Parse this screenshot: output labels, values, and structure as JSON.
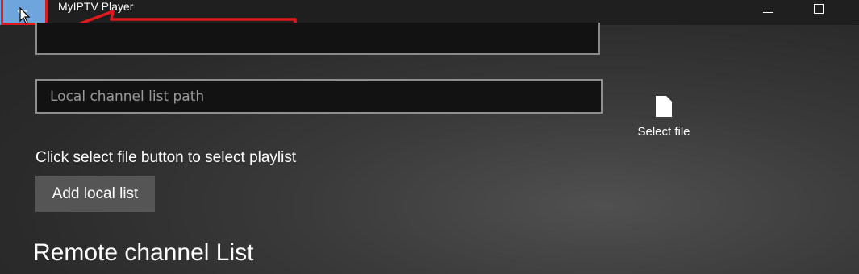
{
  "titlebar": {
    "app_title": "MyIPTV Player",
    "back_icon": "back-arrow-icon",
    "minimize_icon": "minimize-icon",
    "maximize_icon": "maximize-icon"
  },
  "annotations": {
    "highlight_color": "#e0191d",
    "arrow_points_to": "back-button"
  },
  "form": {
    "local_path_placeholder": "Local channel list path",
    "local_path_value": "",
    "select_file_label": "Select file",
    "select_file_icon": "file-icon",
    "helper_text": "Click select file button to select playlist",
    "add_button_label": "Add local list"
  },
  "sections": {
    "remote_title": "Remote channel List"
  },
  "colors": {
    "accent_back_button": "#6ea5dc",
    "input_border": "#8f8f8f",
    "button_bg": "#555555"
  }
}
